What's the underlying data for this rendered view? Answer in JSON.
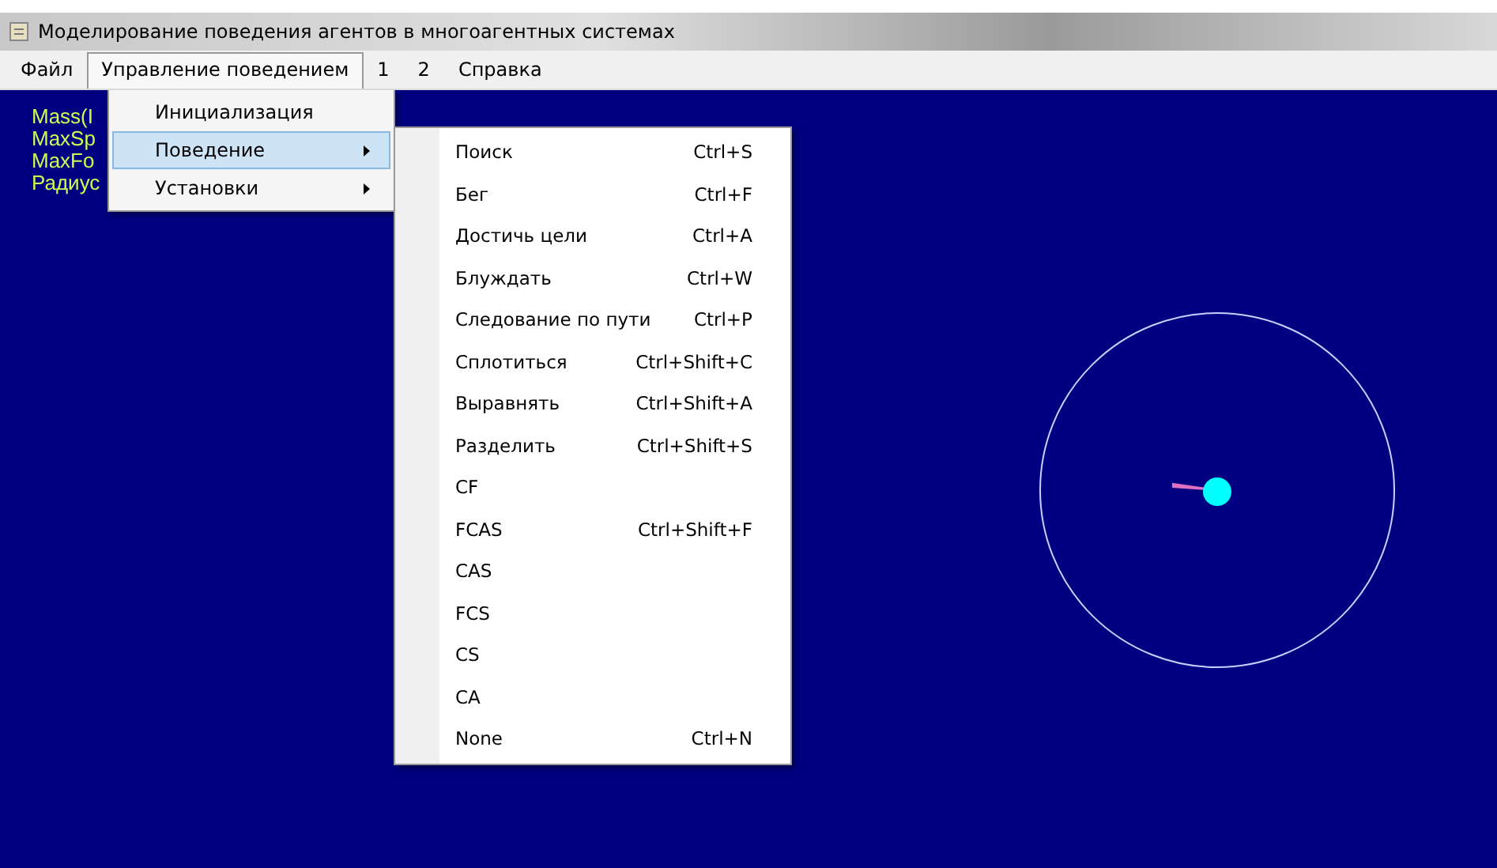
{
  "window": {
    "title": "Моделирование поведения агентов в многоагентных системах"
  },
  "menubar": [
    {
      "label": "Файл",
      "selected": false
    },
    {
      "label": "Управление поведением",
      "selected": true
    },
    {
      "label": "1",
      "selected": false
    },
    {
      "label": "2",
      "selected": false
    },
    {
      "label": "Справка",
      "selected": false
    }
  ],
  "canvas_text": [
    "Mass(I",
    "MaxSp",
    "MaxFo",
    "Радиус"
  ],
  "dropdown": [
    {
      "label": "Инициализация",
      "selected": false,
      "submenu": false
    },
    {
      "label": "Поведение",
      "selected": true,
      "submenu": true
    },
    {
      "label": "Установки",
      "selected": false,
      "submenu": true
    }
  ],
  "submenu": [
    {
      "label": "Поиск",
      "shortcut": "Ctrl+S"
    },
    {
      "label": "Бег",
      "shortcut": "Ctrl+F"
    },
    {
      "label": "Достичь цели",
      "shortcut": "Ctrl+A"
    },
    {
      "label": "Блуждать",
      "shortcut": "Ctrl+W"
    },
    {
      "label": "Следование по пути",
      "shortcut": "Ctrl+P"
    },
    {
      "label": "Сплотиться",
      "shortcut": "Ctrl+Shift+C"
    },
    {
      "label": "Выравнять",
      "shortcut": "Ctrl+Shift+A"
    },
    {
      "label": "Разделить",
      "shortcut": "Ctrl+Shift+S"
    },
    {
      "label": "CF"
    },
    {
      "label": "FCAS",
      "shortcut": "Ctrl+Shift+F"
    },
    {
      "label": "CAS"
    },
    {
      "label": "FCS"
    },
    {
      "label": "CS"
    },
    {
      "label": "CA"
    },
    {
      "label": "None",
      "shortcut": "Ctrl+N"
    }
  ]
}
